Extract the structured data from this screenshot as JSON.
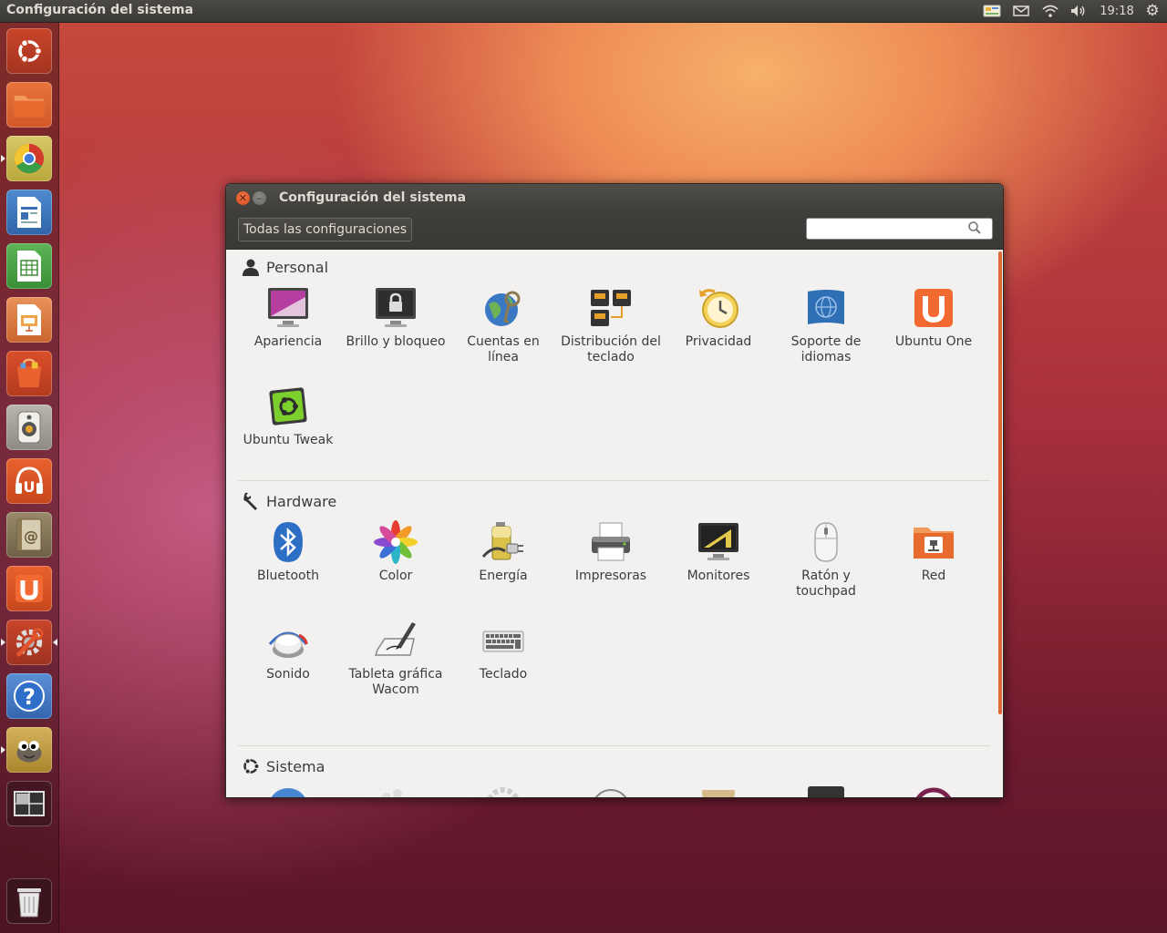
{
  "top_panel": {
    "title": "Configuración del sistema",
    "clock": "19:18"
  },
  "window": {
    "title": "Configuración del sistema",
    "all_settings_label": "Todas las configuraciones",
    "search": {
      "value": "",
      "placeholder": ""
    },
    "sections": {
      "personal": {
        "title": "Personal",
        "items": [
          "Apariencia",
          "Brillo y bloqueo",
          "Cuentas en línea",
          "Distribución del teclado",
          "Privacidad",
          "Soporte de idiomas",
          "Ubuntu One",
          "Ubuntu Tweak"
        ]
      },
      "hardware": {
        "title": "Hardware",
        "items": [
          "Bluetooth",
          "Color",
          "Energía",
          "Impresoras",
          "Monitores",
          "Ratón y touchpad",
          "Red",
          "Sonido",
          "Tableta gráfica Wacom",
          "Teclado"
        ]
      },
      "sistema": {
        "title": "Sistema"
      }
    }
  },
  "launcher": {
    "items": [
      "ubuntu-dash",
      "files",
      "chromium",
      "libreoffice-writer",
      "libreoffice-calc",
      "libreoffice-impress",
      "software-center",
      "rhythmbox",
      "ubuntu-one-music",
      "contacts",
      "ubuntu-one",
      "system-settings",
      "help",
      "gimp",
      "workspace-switcher",
      "trash"
    ]
  },
  "colors": {
    "accent": "#e06a33",
    "panel": "#3c3b37",
    "close": "#e2542b"
  }
}
